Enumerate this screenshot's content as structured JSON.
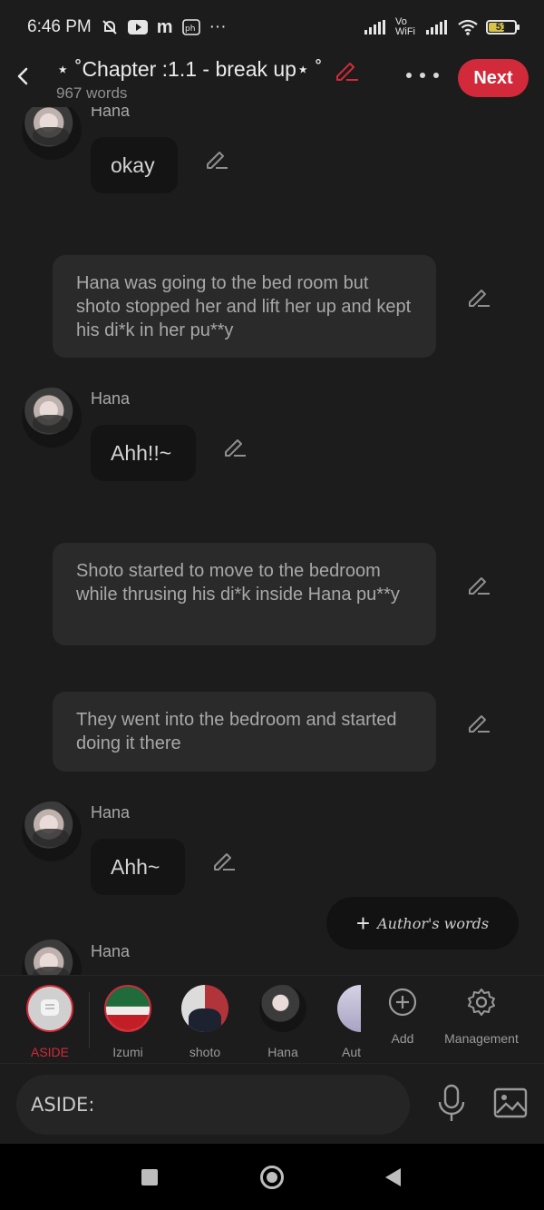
{
  "status_bar": {
    "time": "6:46 PM",
    "more": "···",
    "vowifi": "Vo WiFi",
    "battery": "51"
  },
  "header": {
    "title": "⋆ ˚Chapter :1.1 - break up⋆ ˚",
    "word_count": "967 words",
    "next_label": "Next",
    "accent_color": "#d22a3a"
  },
  "chat": {
    "messages": [
      {
        "type": "dialog",
        "speaker": "Hana",
        "text": "okay"
      },
      {
        "type": "narration",
        "text": "Hana was going to the bed room but shoto stopped her and lift her up and kept his di*k in her pu**y"
      },
      {
        "type": "dialog",
        "speaker": "Hana",
        "text": "Ahh!!~"
      },
      {
        "type": "narration",
        "text": "Shoto started to move to the bedroom while thrusing his di*k inside Hana pu**y"
      },
      {
        "type": "narration",
        "text": "They went into the bedroom and started doing it there"
      },
      {
        "type": "dialog",
        "speaker": "Hana",
        "text": "Ahh~"
      },
      {
        "type": "dialog",
        "speaker": "Hana",
        "text": ""
      }
    ],
    "authors_words_label": "Author's words"
  },
  "character_bar": {
    "characters": [
      {
        "label": "ASIDE"
      },
      {
        "label": "Izumi"
      },
      {
        "label": "shoto"
      },
      {
        "label": "Hana"
      },
      {
        "label": "Aut"
      }
    ],
    "add_label": "Add",
    "management_label": "Management"
  },
  "input": {
    "placeholder": "ASIDE:"
  }
}
